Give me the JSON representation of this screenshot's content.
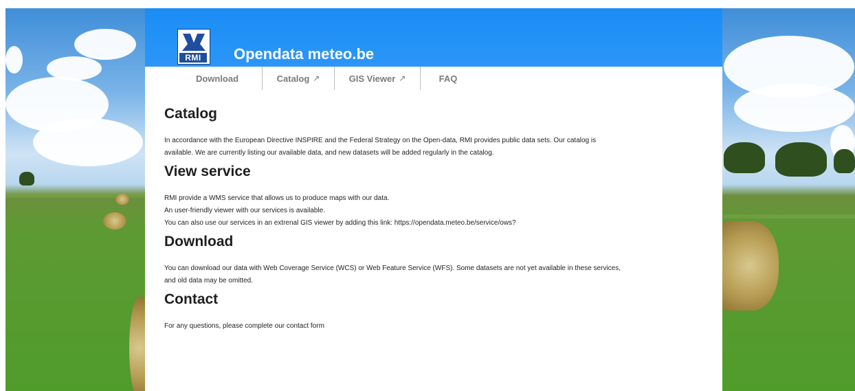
{
  "site": {
    "logo_text": "RMI",
    "title": "Opendata meteo.be"
  },
  "nav": {
    "items": [
      {
        "label": "Download",
        "external": false
      },
      {
        "label": "Catalog",
        "external": true
      },
      {
        "label": "GIS Viewer",
        "external": true
      },
      {
        "label": "FAQ",
        "external": false
      }
    ],
    "external_icon": "↗"
  },
  "sections": {
    "catalog": {
      "heading": "Catalog",
      "lines": [
        "In accordance with the European Directive INSPIRE and the Federal Strategy on the Open-data, RMI provides public data sets. Our catalog is",
        "available. We are currently listing our available data, and new datasets will be added regularly in the catalog."
      ]
    },
    "view_service": {
      "heading": "View service",
      "lines": [
        "RMI provide a WMS service that allows us to produce maps with our data.",
        "An user-friendly viewer with our services is available.",
        "You can also use our services in an extrenal GIS viewer by adding this link: https://opendata.meteo.be/service/ows?"
      ]
    },
    "download": {
      "heading": "Download",
      "lines": [
        "You can download our data with Web Coverage Service (WCS) or Web Feature Service (WFS). Some datasets are not yet available in these services,",
        "and old data may be omitted."
      ]
    },
    "contact": {
      "heading": "Contact",
      "lines": [
        "For any questions, please complete our contact form"
      ]
    }
  },
  "colors": {
    "header_blue": "#1a8df5",
    "nav_text": "#7a7a7a",
    "heading_text": "#1f1f1f"
  }
}
